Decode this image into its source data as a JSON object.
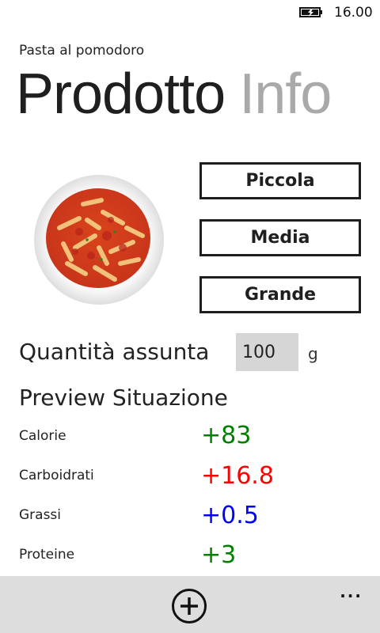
{
  "status_bar": {
    "time": "16.00",
    "battery_icon": "battery-charging-icon"
  },
  "header": {
    "app_title": "Pasta al pomodoro",
    "tabs": [
      {
        "label": "Prodotto",
        "active": true
      },
      {
        "label": "Info",
        "active": false
      }
    ]
  },
  "product": {
    "image_icon": "pasta-plate-image"
  },
  "portion_buttons": {
    "small": "Piccola",
    "medium": "Media",
    "large": "Grande"
  },
  "quantity": {
    "label": "Quantità assunta",
    "value": "100",
    "unit": "g"
  },
  "preview": {
    "title": "Preview Situazione",
    "items": [
      {
        "label": "Calorie",
        "value": "+83",
        "color": "#008000"
      },
      {
        "label": "Carboidrati",
        "value": "+16.8",
        "color": "#ff0000"
      },
      {
        "label": "Grassi",
        "value": "+0.5",
        "color": "#0000ff"
      },
      {
        "label": "Proteine",
        "value": "+3",
        "color": "#008000"
      }
    ]
  },
  "app_bar": {
    "add_icon": "add-circle-icon",
    "more_icon": "more-icon",
    "more_glyph": "..."
  }
}
